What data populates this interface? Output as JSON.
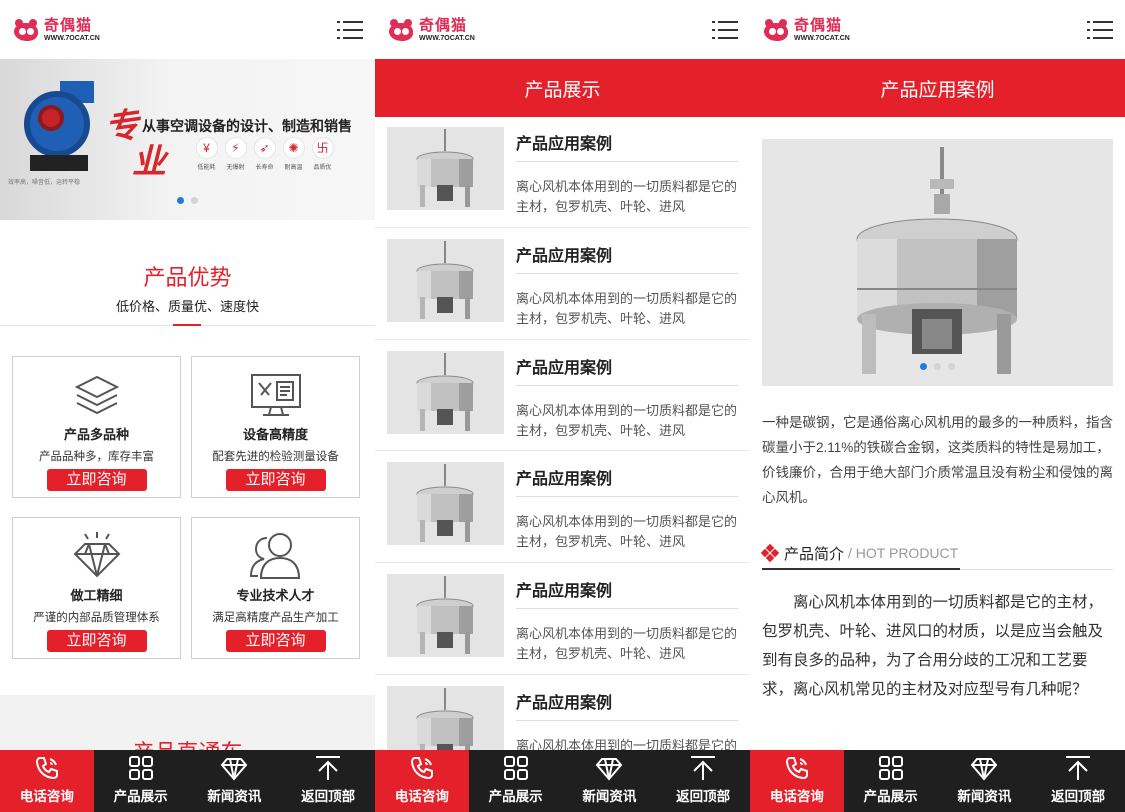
{
  "logo": {
    "cn": "奇偶猫",
    "url": "WWW.7OCAT.CN"
  },
  "panel1": {
    "banner": {
      "big1": "专",
      "big2": "业",
      "slogan": "从事空调设备的设计、制造和销售",
      "features": [
        {
          "label": "低能耗",
          "glyph": "¥"
        },
        {
          "label": "无爆射",
          "glyph": "⚡"
        },
        {
          "label": "长寿命",
          "glyph": "➶"
        },
        {
          "label": "耐高温",
          "glyph": "✺"
        },
        {
          "label": "品质优",
          "glyph": "卐"
        }
      ],
      "small": "效率高，噪音低，运转平稳"
    },
    "advantage": {
      "title": "产品优势",
      "subtitle": "低价格、质量优、速度快"
    },
    "cards": [
      {
        "name": "产品多品种",
        "desc": "产品品种多，库存丰富",
        "btn": "立即咨询",
        "icon": "layers-icon"
      },
      {
        "name": "设备高精度",
        "desc": "配套先进的检验测量设备",
        "btn": "立即咨询",
        "icon": "monitor-tools-icon"
      },
      {
        "name": "做工精细",
        "desc": "严谨的内部品质管理体系",
        "btn": "立即咨询",
        "icon": "diamond-icon"
      },
      {
        "name": "专业技术人才",
        "desc": "满足高精度产品生产加工",
        "btn": "立即咨询",
        "icon": "people-icon"
      }
    ],
    "bottom_title": "产品直通车"
  },
  "panel2": {
    "bar_title": "产品展示",
    "items": [
      {
        "title": "产品应用案例",
        "text": "离心风机本体用到的一切质料都是它的主材，包罗机壳、叶轮、进风"
      },
      {
        "title": "产品应用案例",
        "text": "离心风机本体用到的一切质料都是它的主材，包罗机壳、叶轮、进风"
      },
      {
        "title": "产品应用案例",
        "text": "离心风机本体用到的一切质料都是它的主材，包罗机壳、叶轮、进风"
      },
      {
        "title": "产品应用案例",
        "text": "离心风机本体用到的一切质料都是它的主材，包罗机壳、叶轮、进风"
      },
      {
        "title": "产品应用案例",
        "text": "离心风机本体用到的一切质料都是它的主材，包罗机壳、叶轮、进风"
      },
      {
        "title": "产品应用案例",
        "text": "离心风机本体用到的一切质料都是它的主材，包罗机壳、叶轮、进风"
      }
    ]
  },
  "panel3": {
    "bar_title": "产品应用案例",
    "intro": "一种是碳钢，它是通俗离心风机用的最多的一种质料，指含碳量小于2.11%的铁碳合金钢，这类质料的特性是易加工，价钱廉价，合用于绝大部门介质常温且没有粉尘和侵蚀的离心风机。",
    "section_name": "产品简介",
    "section_en": "/ HOT PRODUCT",
    "article": "离心风机本体用到的一切质料都是它的主材，包罗机壳、叶轮、进风口的材质，以是应当会触及到有良多的品种，为了合用分歧的工况和工艺要求，离心风机常见的主材及对应型号有几种呢？"
  },
  "footer": [
    {
      "label": "电话咨询",
      "icon": "phone-icon"
    },
    {
      "label": "产品展示",
      "icon": "grid-icon"
    },
    {
      "label": "新闻资讯",
      "icon": "diamond-icon"
    },
    {
      "label": "返回顶部",
      "icon": "back-to-top-icon"
    }
  ],
  "colors": {
    "brand_red": "#e4202b",
    "footer_dark": "#1f1f1f",
    "dot_active": "#1d7ddc"
  }
}
